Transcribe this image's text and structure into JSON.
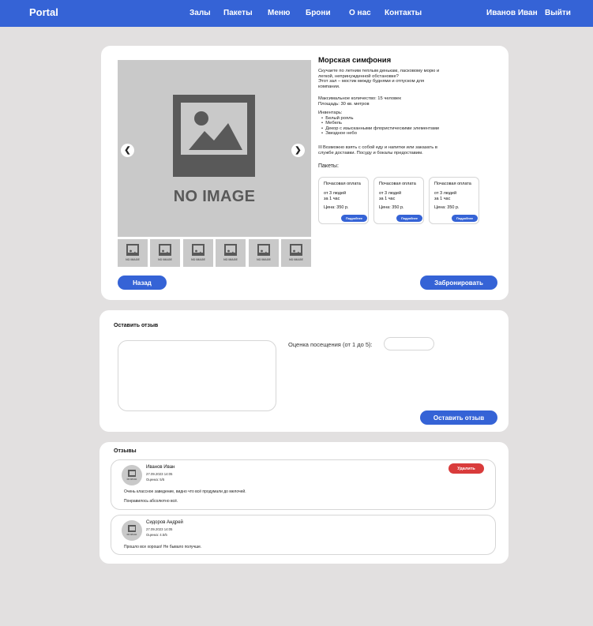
{
  "nav": {
    "brand": "Portal",
    "links": [
      "Залы",
      "Пакеты",
      "Меню",
      "Брони",
      "О нас",
      "Контакты"
    ],
    "user": "Иванов Иван",
    "logout": "Выйти"
  },
  "gallery": {
    "no_image": "NO IMAGE",
    "thumb_text": "NO IMAGE",
    "thumb_count": 6,
    "prev_icon": "chevron-left-icon",
    "next_icon": "chevron-right-icon"
  },
  "hall": {
    "title": "Морская симфония",
    "description": [
      "Скучаете по летним теплым денькам, ласковому морю и",
      "легкой, непринужденной обстановке?",
      "Этот зал – мостик между буднями и отпуском для",
      "компании."
    ],
    "capacity": "Максимальное количество: 15 человек",
    "area": "Площадь: 30 кв. метров",
    "inventory_label": "Инвентарь:",
    "inventory": [
      "Белый рояль",
      "Мебель",
      "Декор с изысканными флористическими элементами",
      "Звездное небо"
    ],
    "food_note": [
      "Возможно взять с собой еду и напитки или заказать в",
      "службе доставки. Посуду и бокалы предоставим."
    ],
    "packages_label": "Пакеты:"
  },
  "packages": [
    {
      "name": "Почасовая оплата",
      "min_people": "от 3 людей",
      "per": "за 1 час",
      "price": "Цена: 350 р.",
      "button": "Подробнее"
    },
    {
      "name": "Почасовая оплата",
      "min_people": "от 3 людей",
      "per": "за 1 час",
      "price": "Цена: 350 р.",
      "button": "Подробнее"
    },
    {
      "name": "Почасовая оплата",
      "min_people": "от 3 людей",
      "per": "за 1 час",
      "price": "Цена: 350 р.",
      "button": "Подробнее"
    }
  ],
  "actions": {
    "back": "Назад",
    "book": "Забронировать"
  },
  "review_form": {
    "title": "Оставить отзыв",
    "rating_label": "Оценка посещения (от 1 до 5):",
    "submit": "Оставить отзыв"
  },
  "reviews": {
    "title": "Отзывы",
    "delete_label": "Удалить",
    "avatar_text": "NO IMAGE",
    "items": [
      {
        "name": "Иванов Иван",
        "date": "27.09.2023 14:05",
        "rating": "Оценка: 5/5",
        "text": [
          "Очень классное заведение, видно что всё продумали до мелочей.",
          "Понравилось абсолютно всё."
        ],
        "deletable": true
      },
      {
        "name": "Сидоров Андрей",
        "date": "27.09.2023 14:05",
        "rating": "Оценка: 4.5/5",
        "text": [
          "Прошло все хорошо! Не бывало получше."
        ],
        "deletable": false
      }
    ]
  },
  "colors": {
    "accent": "#3563d6",
    "danger": "#d93b3b",
    "background": "#e2e0e0",
    "placeholder": "#c9c9c9",
    "placeholder_dark": "#595959"
  }
}
